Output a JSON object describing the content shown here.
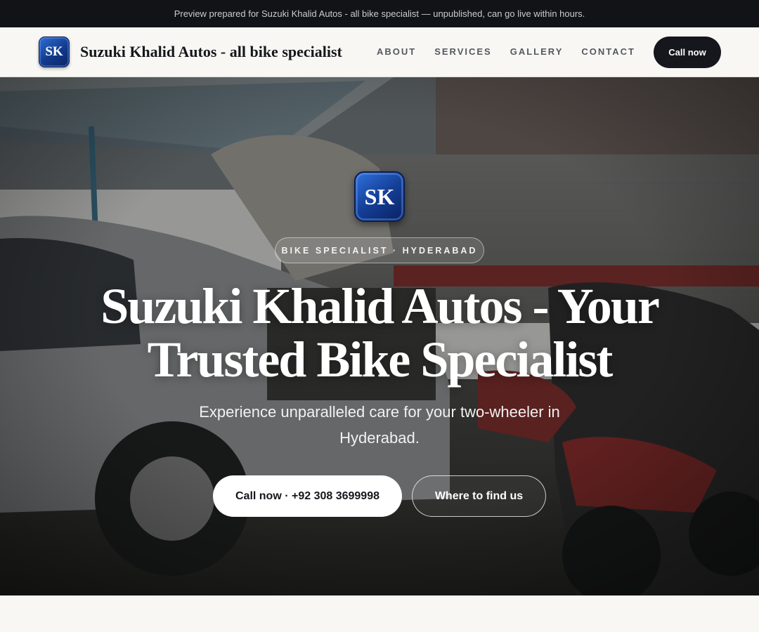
{
  "topbar": {
    "notice": "Preview prepared for Suzuki Khalid Autos - all bike specialist — unpublished, can go live within hours."
  },
  "header": {
    "logo_initials": "SK",
    "brand_name": "Suzuki Khalid Autos - all bike specialist",
    "nav": [
      "ABOUT",
      "SERVICES",
      "GALLERY",
      "CONTACT"
    ],
    "cta_label": "Call now"
  },
  "hero": {
    "logo_initials": "SK",
    "eyebrow": "BIKE SPECIALIST · HYDERABAD",
    "headline": "Suzuki Khalid Autos - Your Trusted Bike Specialist",
    "subtext": "Experience unparalleled care for your two-wheeler in Hyderabad.",
    "primary_button": "Call now · +92 308 3699998",
    "secondary_button": "Where to find us",
    "background_image": "workshop-photo-car-and-motorcycles"
  },
  "colors": {
    "dark": "#15171c",
    "topbar_bg": "#111317",
    "page_bg": "#f8f7f3",
    "logo_blue": "#153f98"
  }
}
